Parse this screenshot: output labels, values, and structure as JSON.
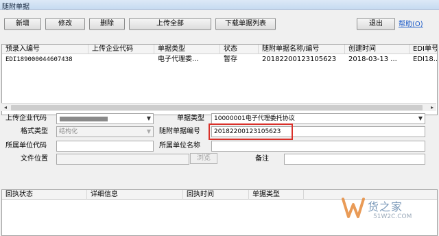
{
  "window": {
    "title": "随附单据"
  },
  "toolbar": {
    "new_label": "新增",
    "edit_label": "修改",
    "delete_label": "删除",
    "upload_all_label": "上传全部",
    "download_list_label": "下载单据列表",
    "exit_label": "退出",
    "help_label": "帮助(O)"
  },
  "doc_table": {
    "columns": [
      "预录入编号",
      "上传企业代码",
      "单据类型",
      "状态",
      "随附单据名称/编号",
      "创建时间",
      "EDI单号"
    ],
    "rows": [
      {
        "pre_entry_no": "EDI189000044607438",
        "company_code": "",
        "doc_type": "电子代理委...",
        "status": "暂存",
        "doc_name_no": "20182200123105623",
        "created": "2018-03-13 ...",
        "edi_no": "EDI18..."
      }
    ]
  },
  "form": {
    "upload_company_label": "上传企业代码",
    "upload_company_value": "",
    "doc_type_label": "单据类型",
    "doc_type_value": "10000001电子代理委托协议",
    "format_label": "格式类型",
    "format_value": "结构化",
    "attached_no_label": "随附单据编号",
    "attached_no_value": "20182200123105623",
    "owner_code_label": "所属单位代码",
    "owner_code_value": "",
    "owner_name_label": "所属单位名称",
    "owner_name_value": "",
    "file_location_label": "文件位置",
    "file_location_value": "",
    "browse_label": "浏览",
    "remarks_label": "备注",
    "remarks_value": ""
  },
  "receipt_table": {
    "columns": [
      "回执状态",
      "详细信息",
      "回执时间",
      "单据类型"
    ]
  },
  "watermark": {
    "brand": "货之家",
    "url": "51W2C.COM"
  },
  "colors": {
    "highlight": "#d9302a",
    "link": "#1a5ac8",
    "watermark": "#7a98b8"
  }
}
